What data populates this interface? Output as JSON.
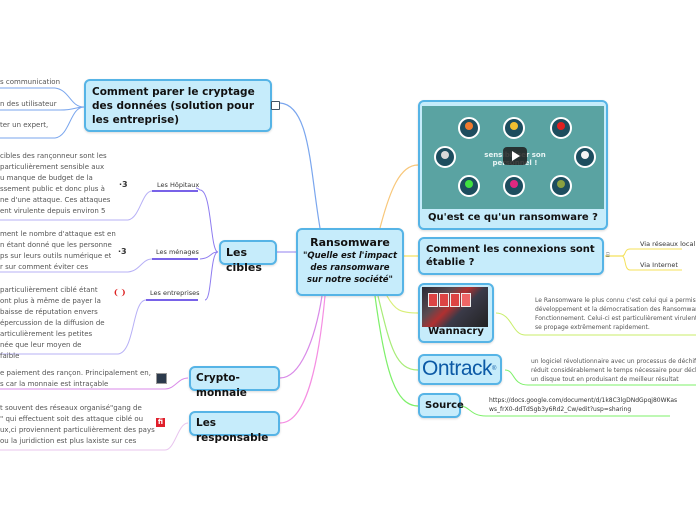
{
  "central": {
    "title": "Ransomware",
    "subtitle": "\"Quelle est l'impact des ransomware sur notre société\""
  },
  "left_topics": {
    "parer": {
      "label": "Comment parer le cryptage des données (solution pour les entreprise)",
      "notes": [
        "s communication",
        "n des utilisateur",
        "ter un expert,"
      ]
    },
    "cibles": {
      "label": "Les cibles",
      "subtopics": [
        {
          "label": "Les Hôpitaux",
          "icon": "number-3-icon",
          "note": [
            "cibles des rançonneur sont les",
            "particulièrement sensible aux",
            "u manque de budget de la",
            "ssement public et donc plus à",
            "ne d'une attaque. Ces attaques",
            "ent virulente depuis environ 5"
          ]
        },
        {
          "label": "Les ménages",
          "icon": "number-3-icon",
          "note": [
            "ment le nombre d'attaque est en",
            "n étant donné que les personne",
            "ps sur leurs outils numérique et",
            "r sur comment éviter ces"
          ]
        },
        {
          "label": "Les entreprises",
          "icon": "red-pair-icon",
          "note": [
            "particulièrement ciblé étant",
            "ont plus à même de payer la",
            "baisse de réputation envers",
            "épercussion de la diffusion de",
            "articulièrement les petites",
            "née que leur moyen de",
            "faible"
          ]
        }
      ]
    },
    "crypto": {
      "label": "Crypto-monnaie",
      "icon": "wikipedia-icon",
      "note": [
        "e paiement des rançon. Principalement en,",
        "s car la monnaie est intraçable"
      ]
    },
    "responsable": {
      "label": "Les responsable",
      "icon": "news-icon",
      "note": [
        "t souvent des réseaux organisé\"gang de",
        "\" qui effectuent soit des attaque ciblé ou",
        "ux,ci proviennent particulièrement des pays",
        "ou la juridiction est plus laxiste sur ces"
      ]
    }
  },
  "right_topics": {
    "video": {
      "label": "Qu'est ce qu'un ransomware ?",
      "overlay_text": "sensibiliser son personnel !"
    },
    "connexions": {
      "label": "Comment les connexions sont établie ?",
      "subtopics": [
        "Via réseaux local",
        "Via Internet"
      ]
    },
    "wannacry": {
      "label": "Wannacry",
      "note": [
        "Le Ransomware le plus connu c'est celui qui a permis le",
        "développement et la démocratisation des Ransomware.",
        "Fonctionnement. Celui-ci est particulièrement virulent et",
        "se propage extrêmement rapidement."
      ]
    },
    "ontrack": {
      "logo_text": "Ontrack",
      "logo_mark": "®",
      "note": [
        "un logiciel révolutionnaire avec un processus de déchiffrement",
        "réduit considérablement le temps nécessaire pour déchiffrer",
        "un disque tout en produisant de meilleur résultat"
      ]
    },
    "source": {
      "label": "Source",
      "url_lines": [
        "https://docs.google.com/document/d/1k8C3lgDNdGpqj80WKas",
        "ws_frX0-ddTdSgb3y6Rd2_Cw/edit?usp=sharing"
      ]
    }
  },
  "colors": {
    "topic_fill": "#c6ecfb",
    "topic_border": "#56b4e6",
    "branch_blue": "#7aa6ee",
    "branch_purple": "#8e7cf0",
    "branch_purple_dark": "#4b2ee0",
    "branch_magenta": "#d98ae8",
    "branch_pink": "#f58ee2",
    "branch_orange": "#f8c77a",
    "branch_yellow": "#f4e15a",
    "branch_lime": "#c8ee6a",
    "branch_green": "#7ef06a"
  }
}
